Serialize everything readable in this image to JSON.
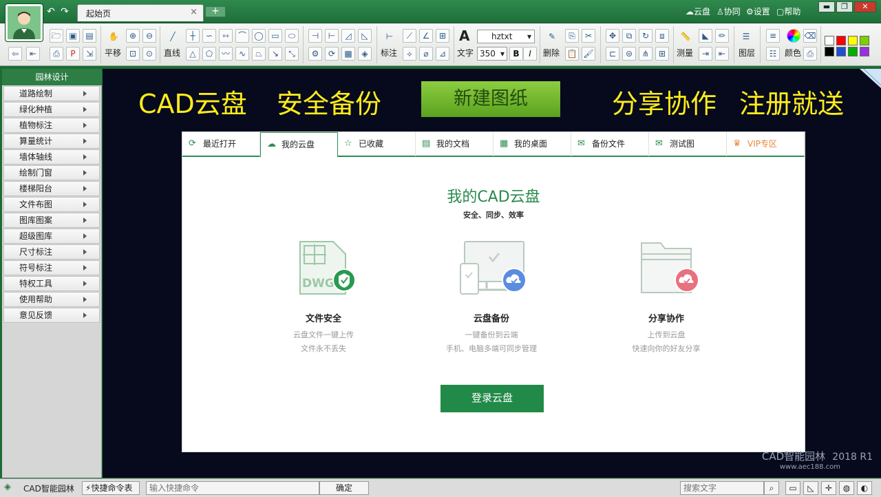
{
  "window": {
    "tab_title": "起始页",
    "tab_close": "×",
    "tab_add": "+",
    "top_links": [
      "云盘",
      "协同",
      "设置",
      "帮助"
    ],
    "win_controls": [
      "▬",
      "❐",
      "✕"
    ]
  },
  "toolbar": {
    "pan_label": "平移",
    "line_label": "直线",
    "annotate_label": "标注",
    "text_label": "文字",
    "delete_label": "删除",
    "measure_label": "测量",
    "layer_label": "图层",
    "color_label": "颜色",
    "font_value": "hztxt",
    "size_value": "350",
    "bold": "B",
    "italic": "I",
    "swatch_colors": [
      "#ffffff",
      "#ff0000",
      "#ffff00",
      "#7fd000",
      "#000000",
      "#1f4fd0",
      "#00b000",
      "#9a2fe0"
    ]
  },
  "sidebar": {
    "title": "园林设计",
    "items": [
      "道路绘制",
      "绿化种植",
      "植物标注",
      "算量统计",
      "墙体轴线",
      "绘制门窗",
      "楼梯阳台",
      "文件布图",
      "图库图案",
      "超级图库",
      "尺寸标注",
      "符号标注",
      "特权工具",
      "使用帮助",
      "意见反馈"
    ]
  },
  "banner": {
    "left1": "CAD云盘",
    "left2": "安全备份",
    "new_button": "新建图纸",
    "right1": "分享协作",
    "right2": "注册就送"
  },
  "panel": {
    "tabs": [
      "最近打开",
      "我的云盘",
      "已收藏",
      "我的文档",
      "我的桌面",
      "备份文件",
      "测试图",
      "VIP专区"
    ],
    "title": "我的CAD云盘",
    "subtitle": "安全、同步、效率",
    "features": [
      {
        "title": "文件安全",
        "line1": "云盘文件一键上传",
        "line2": "文件永不丢失",
        "icon_text": "DWG"
      },
      {
        "title": "云盘备份",
        "line1": "一键备份到云端",
        "line2": "手机、电脑多端可同步管理"
      },
      {
        "title": "分享协作",
        "line1": "上传到云盘",
        "line2": "快速向你的好友分享"
      }
    ],
    "login_button": "登录云盘",
    "accent": "#218a48"
  },
  "logo": {
    "name": "CAD智能园林",
    "version": "2018 R1",
    "url": "www.aec188.com"
  },
  "status": {
    "app_name": "CAD智能园林",
    "shortcut_table": "快捷命令表",
    "cmd_placeholder": "输入快捷命令",
    "ok": "确定",
    "search_placeholder": "搜索文字"
  }
}
